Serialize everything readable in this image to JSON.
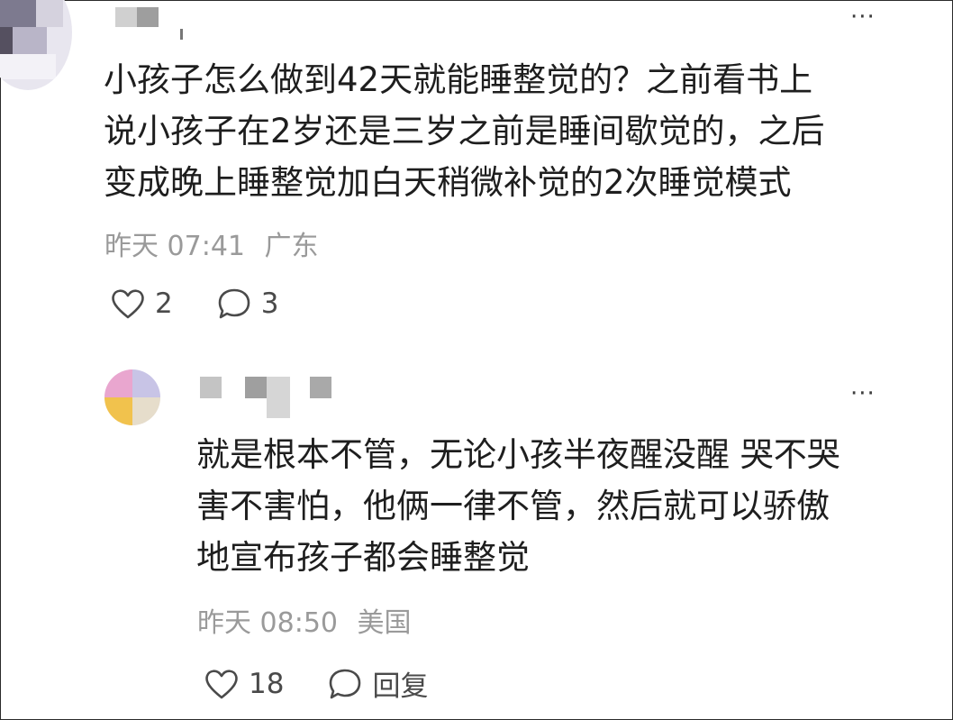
{
  "comment": {
    "lines": [
      "小孩子怎么做到42天就能睡整觉的？之前看书上",
      "说小孩子在2岁还是三岁之前是睡间歇觉的，之后",
      "变成晚上睡整觉加白天稍微补觉的2次睡觉模式"
    ],
    "time": "昨天 07:41",
    "location": "广东",
    "likes": "2",
    "replies": "3",
    "more": "···"
  },
  "reply": {
    "lines": [
      "就是根本不管，无论小孩半夜醒没醒 哭不哭",
      "害不害怕，他俩一律不管，然后就可以骄傲",
      "地宣布孩子都会睡整觉"
    ],
    "time": "昨天 08:50",
    "location": "美国",
    "likes": "18",
    "reply_label": "回复",
    "more": "···"
  },
  "icons": {
    "like": "heart-outline-icon",
    "comment": "speech-bubble-icon",
    "more": "more-horizontal-icon"
  },
  "colors": {
    "text": "#1e1e1e",
    "meta": "#9a9a9a",
    "icon": "#4a4a4a"
  }
}
